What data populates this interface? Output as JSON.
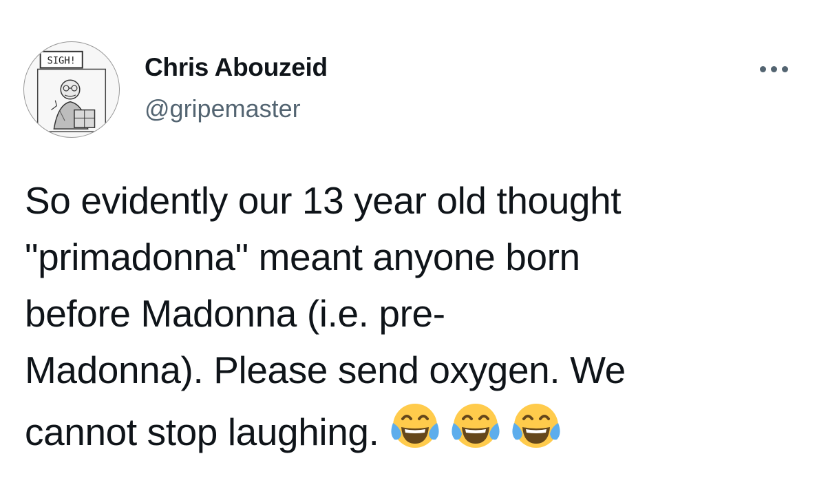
{
  "author": {
    "display_name": "Chris Abouzeid",
    "handle": "@gripemaster",
    "avatar_sign_text": "SIGH!"
  },
  "tweet": {
    "lines": [
      "So evidently our 13 year old thought",
      "\"primadonna\" meant anyone born",
      "before Madonna (i.e. pre-",
      "Madonna). Please send oxygen. We",
      "cannot stop laughing."
    ],
    "emojis": [
      "face-with-tears-of-joy-icon",
      "face-with-tears-of-joy-icon",
      "face-with-tears-of-joy-icon"
    ]
  },
  "colors": {
    "text": "#0f1419",
    "secondary": "#536471",
    "emoji_face": "#FFCB4C",
    "emoji_tears": "#5DADEC"
  }
}
